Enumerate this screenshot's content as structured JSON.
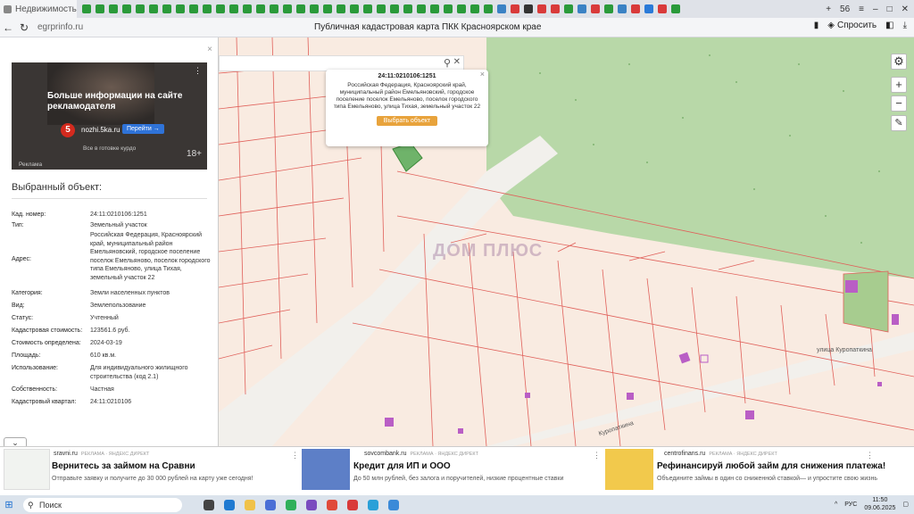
{
  "browser": {
    "active_tab": "Недвижимость",
    "url": "egrprinfo.ru",
    "page_title": "Публичная кадастровая карта ПКК Красноярском крае",
    "ask_label": "Спросить",
    "tab_count": "56"
  },
  "ad_banner": {
    "headline": "Больше информации на сайте рекламодателя",
    "site": "nozhi.5ka.ru",
    "logo": "5",
    "go_label": "Перейти →",
    "subline": "Все в готовке курдо",
    "label": "Реклама",
    "age": "18+"
  },
  "panel": {
    "heading": "Выбранный объект:",
    "rows": [
      {
        "label": "Кад. номер:",
        "value": "24:11:0210106:1251"
      },
      {
        "label": "Тип:",
        "value": "Земельный участок"
      },
      {
        "label": "Адрес:",
        "value": "Российская Федерация, Красноярский край, муниципальный район Емельяновский, городское поселение поселок Емельяново, поселок городского типа Емельяново, улица Тихая, земельный участок 22"
      },
      {
        "label": "Категория:",
        "value": "Земли населенных пунктов"
      },
      {
        "label": "Вид:",
        "value": "Землепользование"
      },
      {
        "label": "Статус:",
        "value": "Учтенный"
      },
      {
        "label": "Кадастровая стоимость:",
        "value": "123561.6 руб."
      },
      {
        "label": "Стоимость определена:",
        "value": "2024-03-19"
      },
      {
        "label": "Площадь:",
        "value": "610 кв.м."
      },
      {
        "label": "Использование:",
        "value": "Для индивидуального жилищного строительства (код 2.1)"
      },
      {
        "label": "Собственность:",
        "value": "Частная"
      },
      {
        "label": "Кадастровый квартал:",
        "value": "24:11:0210106"
      }
    ]
  },
  "popup": {
    "title": "24:11:0210106:1251",
    "address": "Российская Федерация, Красноярский край, муниципальный район Емельяновский, городское поселение поселок Емельяново, поселок городского типа Емельяново, улица Тихая, земельный участок 22",
    "button": "Выбрать объект"
  },
  "map": {
    "street_1": "улица Куропаткина",
    "street_2": "Куропаткина",
    "watermark": "ДОМ ПЛЮС"
  },
  "ads": [
    {
      "domain": "sravni.ru",
      "tag": "РЕКЛАМА · ЯНДЕКС ДИРЕКТ",
      "head": "Вернитесь за займом на Сравни",
      "desc": "Отправьте заявку и получите до 30 000 рублей на карту уже сегодня!"
    },
    {
      "domain": "sovcombank.ru",
      "tag": "РЕКЛАМА · ЯНДЕКС ДИРЕКТ",
      "head": "Кредит для ИП и ООО",
      "desc": "До 50 млн рублей, без залога и поручителей, низкие процентные ставки"
    },
    {
      "domain": "centrofinans.ru",
      "tag": "РЕКЛАМА · ЯНДЕКС ДИРЕКТ",
      "head": "Рефинансируй любой займ для снижения платежа!",
      "desc": "Объедините займы в один со сниженной ставкой— и упростите свою жизнь"
    }
  ],
  "taskbar": {
    "search_label": "Поиск",
    "lang": "РУС",
    "time": "11:50",
    "date": "09.06.2025"
  },
  "colors": {
    "parcel_fill": "#f9ebe1",
    "parcel_stroke": "#e0605a",
    "forest": "#b8d8a8",
    "selected_parcel": "#6fb36a",
    "road": "#f2f0ec"
  }
}
